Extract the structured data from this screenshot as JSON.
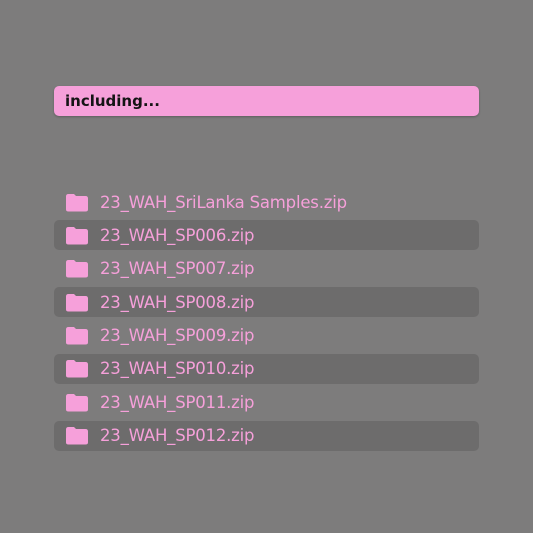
{
  "search": {
    "value": "including...",
    "bg_color": "#f6a0da"
  },
  "icon": "folder-icon",
  "colors": {
    "background": "#7d7c7c",
    "accent": "#f6a0da",
    "row_alt": "#6d6c6c"
  },
  "files": [
    {
      "name": "23_WAH_SriLanka Samples.zip"
    },
    {
      "name": "23_WAH_SP006.zip"
    },
    {
      "name": "23_WAH_SP007.zip"
    },
    {
      "name": "23_WAH_SP008.zip"
    },
    {
      "name": "23_WAH_SP009.zip"
    },
    {
      "name": "23_WAH_SP010.zip"
    },
    {
      "name": "23_WAH_SP011.zip"
    },
    {
      "name": "23_WAH_SP012.zip"
    }
  ]
}
